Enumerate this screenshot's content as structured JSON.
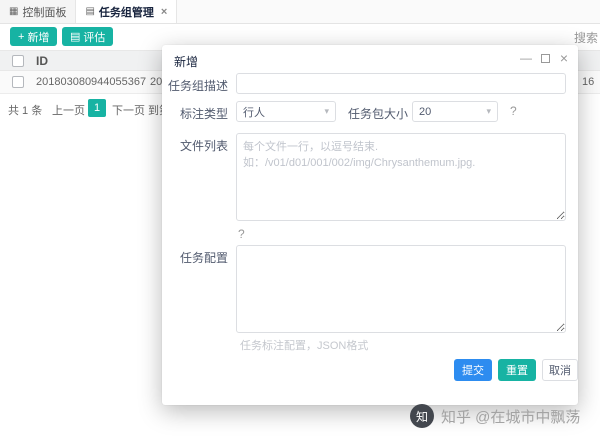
{
  "tabs": {
    "tab1": "控制面板",
    "tab2": "任务组管理"
  },
  "icons": {
    "grid": "▦",
    "list": "▤",
    "plus": "+",
    "close": "×",
    "caret": "▾",
    "minimize": "—",
    "help": "?",
    "zhihu": "知"
  },
  "toolbar": {
    "add_label": "新增",
    "eval_label": "评估",
    "search_fragment": "搜索"
  },
  "table": {
    "header_id": "ID",
    "row_id": "201803080944055367",
    "row_fragment_mid": "20",
    "row_fragment_right": "16"
  },
  "pagination": {
    "total": "共 1 条",
    "prev": "上一页",
    "current": "1",
    "next": "下一页",
    "goto": "到第"
  },
  "modal": {
    "title": "新增",
    "fields": {
      "desc_label": "任务组描述",
      "desc_value": "",
      "type_label": "标注类型",
      "type_value": "行人",
      "size_label": "任务包大小",
      "size_value": "20",
      "files_label": "文件列表",
      "files_placeholder": "每个文件一行，以逗号结束.如：/v01/d01/001/002/img/Chrysanthemum.jpg.",
      "config_label": "任务配置",
      "config_hint": "任务标注配置，JSON格式"
    },
    "footer": {
      "submit": "提交",
      "reset": "重置",
      "cancel": "取消"
    }
  },
  "watermark": {
    "text": "知乎 @在城市中飘荡"
  },
  "colors": {
    "teal": "#17b3a3",
    "blue": "#2d8cf0"
  }
}
